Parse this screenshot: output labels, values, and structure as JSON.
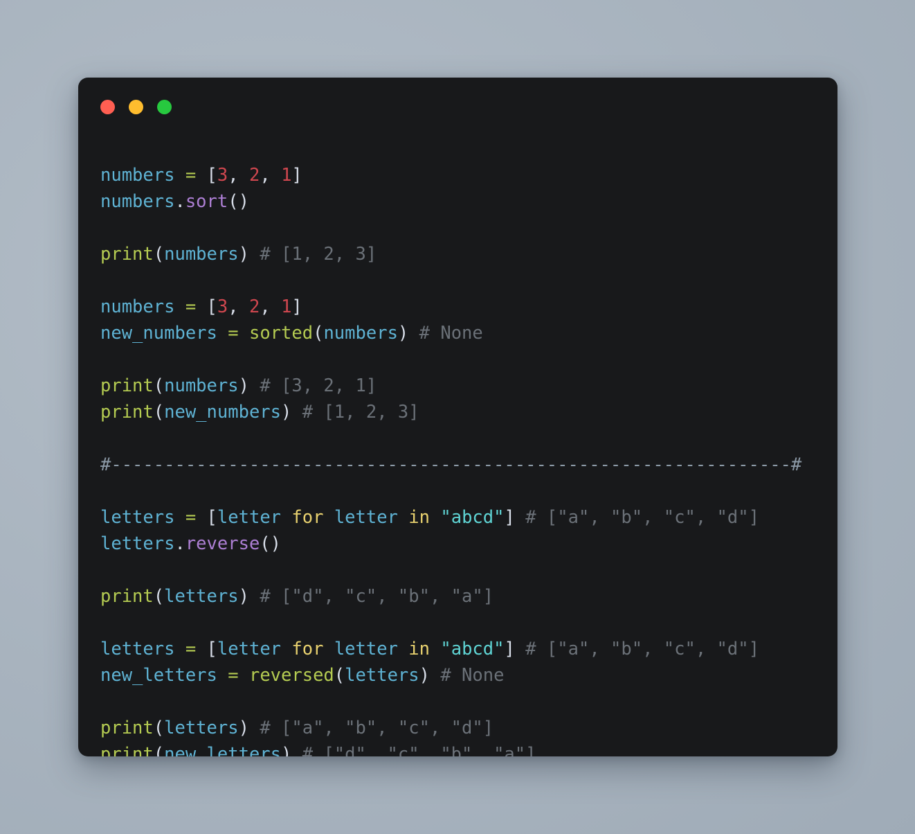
{
  "window": {
    "background_color": "#18191b",
    "desktop_color": "#aab5c0",
    "traffic_lights": [
      {
        "name": "close",
        "color": "#ff5f52"
      },
      {
        "name": "minimize",
        "color": "#ffbd2e"
      },
      {
        "name": "maximize",
        "color": "#27c93f"
      }
    ]
  },
  "theme": {
    "variable": "#5fb3d4",
    "operator": "#b5cc52",
    "number": "#d0474f",
    "function": "#b5cc52",
    "method": "#ad7fd4",
    "keyword": "#e8d16f",
    "string": "#5fd4d4",
    "comment": "#6b7178",
    "punctuation": "#d8dee9"
  },
  "code": {
    "language": "python",
    "plain_text": "numbers = [3, 2, 1]\nnumbers.sort()\n\nprint(numbers) # [1, 2, 3]\n\nnumbers = [3, 2, 1]\nnew_numbers = sorted(numbers) # None\n\nprint(numbers) # [3, 2, 1]\nprint(new_numbers) # [1, 2, 3]\n\n#----------------------------------------------------------------#\n\nletters = [letter for letter in \"abcd\"] # [\"a\", \"b\", \"c\", \"d\"]\nletters.reverse()\n\nprint(letters) # [\"d\", \"c\", \"b\", \"a\"]\n\nletters = [letter for letter in \"abcd\"] # [\"a\", \"b\", \"c\", \"d\"]\nnew_letters = reversed(letters) # None\n\nprint(letters) # [\"a\", \"b\", \"c\", \"d\"]\nprint(new_letters) # [\"d\", \"c\", \"b\", \"a\"]",
    "lines": [
      {
        "id": "l1",
        "text": "numbers = [3, 2, 1]"
      },
      {
        "id": "l2",
        "text": "numbers.sort()"
      },
      {
        "id": "l3",
        "text": ""
      },
      {
        "id": "l4",
        "text": "print(numbers) # [1, 2, 3]"
      },
      {
        "id": "l5",
        "text": ""
      },
      {
        "id": "l6",
        "text": "numbers = [3, 2, 1]"
      },
      {
        "id": "l7",
        "text": "new_numbers = sorted(numbers) # None"
      },
      {
        "id": "l8",
        "text": ""
      },
      {
        "id": "l9",
        "text": "print(numbers) # [3, 2, 1]"
      },
      {
        "id": "l10",
        "text": "print(new_numbers) # [1, 2, 3]"
      },
      {
        "id": "l11",
        "text": ""
      },
      {
        "id": "l12",
        "text": "#----------------------------------------------------------------#"
      },
      {
        "id": "l13",
        "text": ""
      },
      {
        "id": "l14",
        "text": "letters = [letter for letter in \"abcd\"] # [\"a\", \"b\", \"c\", \"d\"]"
      },
      {
        "id": "l15",
        "text": "letters.reverse()"
      },
      {
        "id": "l16",
        "text": ""
      },
      {
        "id": "l17",
        "text": "print(letters) # [\"d\", \"c\", \"b\", \"a\"]"
      },
      {
        "id": "l18",
        "text": ""
      },
      {
        "id": "l19",
        "text": "letters = [letter for letter in \"abcd\"] # [\"a\", \"b\", \"c\", \"d\"]"
      },
      {
        "id": "l20",
        "text": "new_letters = reversed(letters) # None"
      },
      {
        "id": "l21",
        "text": ""
      },
      {
        "id": "l22",
        "text": "print(letters) # [\"a\", \"b\", \"c\", \"d\"]"
      },
      {
        "id": "l23",
        "text": "print(new_letters) # [\"d\", \"c\", \"b\", \"a\"]"
      }
    ],
    "tokens": [
      [
        {
          "t": "numbers",
          "c": "var"
        },
        {
          "t": " ",
          "c": "punc"
        },
        {
          "t": "=",
          "c": "op"
        },
        {
          "t": " ",
          "c": "punc"
        },
        {
          "t": "[",
          "c": "punc"
        },
        {
          "t": "3",
          "c": "num"
        },
        {
          "t": ", ",
          "c": "punc"
        },
        {
          "t": "2",
          "c": "num"
        },
        {
          "t": ", ",
          "c": "punc"
        },
        {
          "t": "1",
          "c": "num"
        },
        {
          "t": "]",
          "c": "punc"
        }
      ],
      [
        {
          "t": "numbers",
          "c": "var"
        },
        {
          "t": ".",
          "c": "punc"
        },
        {
          "t": "sort",
          "c": "method"
        },
        {
          "t": "()",
          "c": "punc"
        }
      ],
      [],
      [
        {
          "t": "print",
          "c": "fn"
        },
        {
          "t": "(",
          "c": "punc"
        },
        {
          "t": "numbers",
          "c": "var"
        },
        {
          "t": ")",
          "c": "punc"
        },
        {
          "t": " ",
          "c": "punc"
        },
        {
          "t": "# [1, 2, 3]",
          "c": "comment"
        }
      ],
      [],
      [
        {
          "t": "numbers",
          "c": "var"
        },
        {
          "t": " ",
          "c": "punc"
        },
        {
          "t": "=",
          "c": "op"
        },
        {
          "t": " ",
          "c": "punc"
        },
        {
          "t": "[",
          "c": "punc"
        },
        {
          "t": "3",
          "c": "num"
        },
        {
          "t": ", ",
          "c": "punc"
        },
        {
          "t": "2",
          "c": "num"
        },
        {
          "t": ", ",
          "c": "punc"
        },
        {
          "t": "1",
          "c": "num"
        },
        {
          "t": "]",
          "c": "punc"
        }
      ],
      [
        {
          "t": "new_numbers",
          "c": "var"
        },
        {
          "t": " ",
          "c": "punc"
        },
        {
          "t": "=",
          "c": "op"
        },
        {
          "t": " ",
          "c": "punc"
        },
        {
          "t": "sorted",
          "c": "fn"
        },
        {
          "t": "(",
          "c": "punc"
        },
        {
          "t": "numbers",
          "c": "var"
        },
        {
          "t": ")",
          "c": "punc"
        },
        {
          "t": " ",
          "c": "punc"
        },
        {
          "t": "# None",
          "c": "comment"
        }
      ],
      [],
      [
        {
          "t": "print",
          "c": "fn"
        },
        {
          "t": "(",
          "c": "punc"
        },
        {
          "t": "numbers",
          "c": "var"
        },
        {
          "t": ")",
          "c": "punc"
        },
        {
          "t": " ",
          "c": "punc"
        },
        {
          "t": "# [3, 2, 1]",
          "c": "comment"
        }
      ],
      [
        {
          "t": "print",
          "c": "fn"
        },
        {
          "t": "(",
          "c": "punc"
        },
        {
          "t": "new_numbers",
          "c": "var"
        },
        {
          "t": ")",
          "c": "punc"
        },
        {
          "t": " ",
          "c": "punc"
        },
        {
          "t": "# [1, 2, 3]",
          "c": "comment"
        }
      ],
      [],
      [
        {
          "t": "#----------------------------------------------------------------#",
          "c": "sep"
        }
      ],
      [],
      [
        {
          "t": "letters",
          "c": "var"
        },
        {
          "t": " ",
          "c": "punc"
        },
        {
          "t": "=",
          "c": "op"
        },
        {
          "t": " ",
          "c": "punc"
        },
        {
          "t": "[",
          "c": "punc"
        },
        {
          "t": "letter",
          "c": "var"
        },
        {
          "t": " ",
          "c": "punc"
        },
        {
          "t": "for",
          "c": "kw"
        },
        {
          "t": " ",
          "c": "punc"
        },
        {
          "t": "letter",
          "c": "var"
        },
        {
          "t": " ",
          "c": "punc"
        },
        {
          "t": "in",
          "c": "kw"
        },
        {
          "t": " ",
          "c": "punc"
        },
        {
          "t": "\"abcd\"",
          "c": "str"
        },
        {
          "t": "]",
          "c": "punc"
        },
        {
          "t": " ",
          "c": "punc"
        },
        {
          "t": "# [\"a\", \"b\", \"c\", \"d\"]",
          "c": "comment"
        }
      ],
      [
        {
          "t": "letters",
          "c": "var"
        },
        {
          "t": ".",
          "c": "punc"
        },
        {
          "t": "reverse",
          "c": "method"
        },
        {
          "t": "()",
          "c": "punc"
        }
      ],
      [],
      [
        {
          "t": "print",
          "c": "fn"
        },
        {
          "t": "(",
          "c": "punc"
        },
        {
          "t": "letters",
          "c": "var"
        },
        {
          "t": ")",
          "c": "punc"
        },
        {
          "t": " ",
          "c": "punc"
        },
        {
          "t": "# [\"d\", \"c\", \"b\", \"a\"]",
          "c": "comment"
        }
      ],
      [],
      [
        {
          "t": "letters",
          "c": "var"
        },
        {
          "t": " ",
          "c": "punc"
        },
        {
          "t": "=",
          "c": "op"
        },
        {
          "t": " ",
          "c": "punc"
        },
        {
          "t": "[",
          "c": "punc"
        },
        {
          "t": "letter",
          "c": "var"
        },
        {
          "t": " ",
          "c": "punc"
        },
        {
          "t": "for",
          "c": "kw"
        },
        {
          "t": " ",
          "c": "punc"
        },
        {
          "t": "letter",
          "c": "var"
        },
        {
          "t": " ",
          "c": "punc"
        },
        {
          "t": "in",
          "c": "kw"
        },
        {
          "t": " ",
          "c": "punc"
        },
        {
          "t": "\"abcd\"",
          "c": "str"
        },
        {
          "t": "]",
          "c": "punc"
        },
        {
          "t": " ",
          "c": "punc"
        },
        {
          "t": "# [\"a\", \"b\", \"c\", \"d\"]",
          "c": "comment"
        }
      ],
      [
        {
          "t": "new_letters",
          "c": "var"
        },
        {
          "t": " ",
          "c": "punc"
        },
        {
          "t": "=",
          "c": "op"
        },
        {
          "t": " ",
          "c": "punc"
        },
        {
          "t": "reversed",
          "c": "fn"
        },
        {
          "t": "(",
          "c": "punc"
        },
        {
          "t": "letters",
          "c": "var"
        },
        {
          "t": ")",
          "c": "punc"
        },
        {
          "t": " ",
          "c": "punc"
        },
        {
          "t": "# None",
          "c": "comment"
        }
      ],
      [],
      [
        {
          "t": "print",
          "c": "fn"
        },
        {
          "t": "(",
          "c": "punc"
        },
        {
          "t": "letters",
          "c": "var"
        },
        {
          "t": ")",
          "c": "punc"
        },
        {
          "t": " ",
          "c": "punc"
        },
        {
          "t": "# [\"a\", \"b\", \"c\", \"d\"]",
          "c": "comment"
        }
      ],
      [
        {
          "t": "print",
          "c": "fn"
        },
        {
          "t": "(",
          "c": "punc"
        },
        {
          "t": "new_letters",
          "c": "var"
        },
        {
          "t": ")",
          "c": "punc"
        },
        {
          "t": " ",
          "c": "punc"
        },
        {
          "t": "# [\"d\", \"c\", \"b\", \"a\"]",
          "c": "comment"
        }
      ]
    ]
  }
}
